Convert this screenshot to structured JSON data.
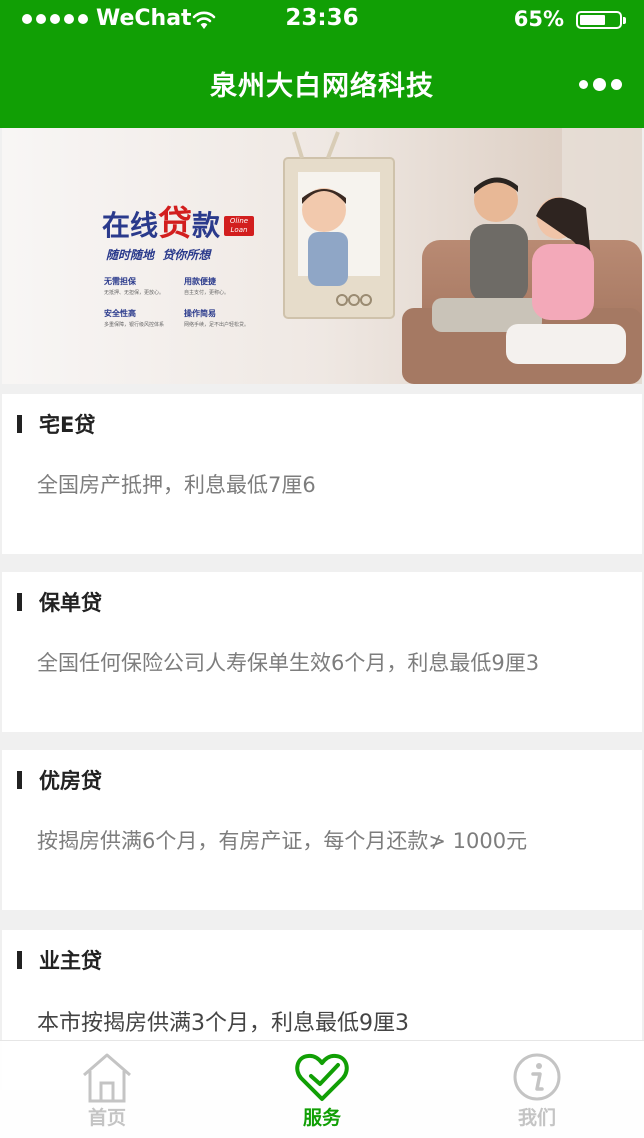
{
  "status_bar": {
    "carrier": "WeChat",
    "time": "23:36",
    "battery_percent": "65%",
    "battery_level": 0.65
  },
  "nav": {
    "title": "泉州大白网络科技",
    "more_icon": "more-dots-icon"
  },
  "banner": {
    "headline_part1": "在线",
    "headline_part2": "贷",
    "headline_part3": "款",
    "badge_line1": "Oline",
    "badge_line2": "Loan",
    "slogan": "随时随地  贷你所想",
    "features": [
      {
        "title": "无需担保",
        "desc": "无抵押、无担保，更放心。"
      },
      {
        "title": "用款便捷",
        "desc": "自主支付，更称心。"
      },
      {
        "title": "安全性高",
        "desc": "多重保障，银行级风控体系"
      },
      {
        "title": "操作简易",
        "desc": "网络手续，足不出户轻松贷。"
      }
    ]
  },
  "products": [
    {
      "title": "宅E贷",
      "desc": "全国房产抵押，利息最低7厘6"
    },
    {
      "title": "保单贷",
      "desc": "全国任何保险公司人寿保单生效6个月，利息最低9厘3"
    },
    {
      "title": "优房贷",
      "desc": "按揭房供满6个月，有房产证，每个月还款≯ 1000元"
    },
    {
      "title": "业主贷",
      "desc": "本市按揭房供满3个月，利息最低9厘3"
    }
  ],
  "tabs": [
    {
      "label": "首页",
      "icon": "home-icon",
      "active": false
    },
    {
      "label": "服务",
      "icon": "heart-check-icon",
      "active": true
    },
    {
      "label": "我们",
      "icon": "info-icon",
      "active": false
    }
  ],
  "colors": {
    "brand_green": "#119f05",
    "tab_inactive": "#c4c4c4",
    "text_dark": "#222222",
    "text_gray": "#7d7d7d"
  }
}
